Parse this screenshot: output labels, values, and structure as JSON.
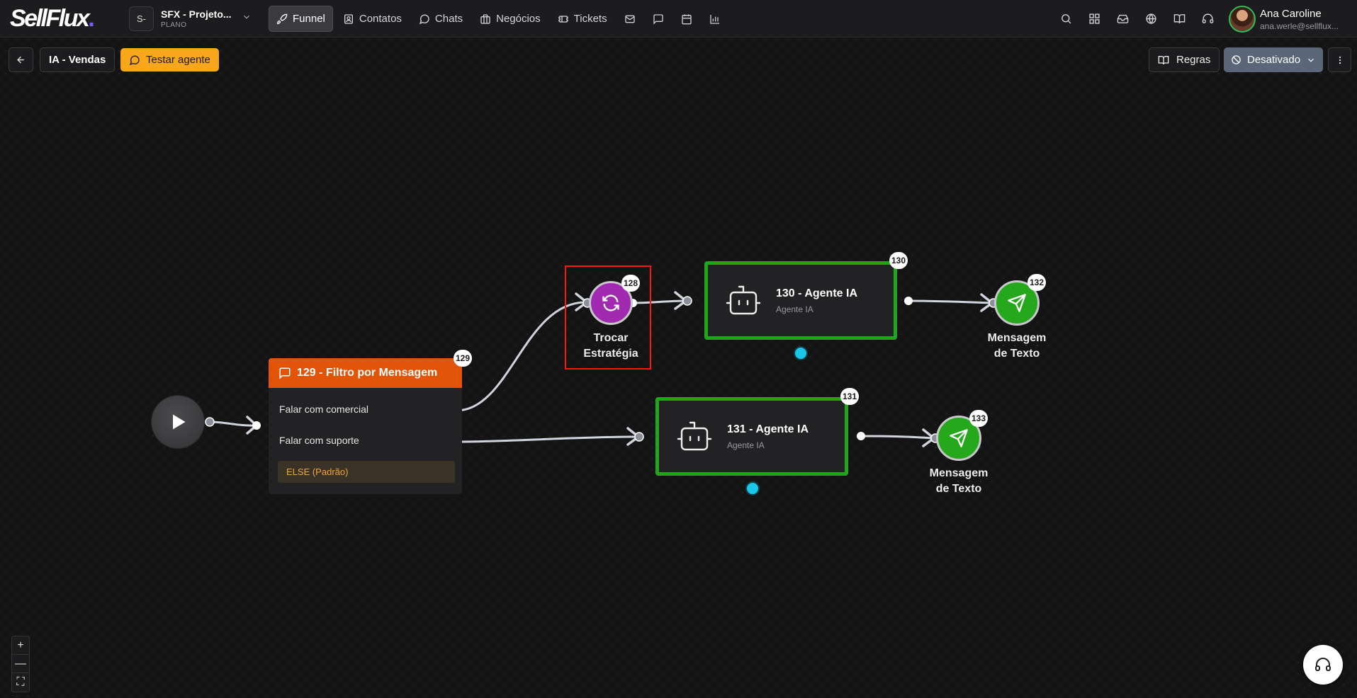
{
  "brand": {
    "logo_text": "SellFlux",
    "logo_dot": "."
  },
  "project": {
    "avatar": "S-",
    "name": "SFX - Projeto...",
    "plan": "PLANO"
  },
  "nav": {
    "items": [
      {
        "label": "Funnel",
        "icon": "rocket-icon",
        "active": true
      },
      {
        "label": "Contatos",
        "icon": "contacts-icon"
      },
      {
        "label": "Chats",
        "icon": "chat-icon"
      },
      {
        "label": "Negócios",
        "icon": "briefcase-icon"
      },
      {
        "label": "Tickets",
        "icon": "ticket-icon"
      }
    ],
    "icon_items": [
      "mail-icon",
      "message-square-icon",
      "calendar-icon",
      "bar-chart-icon"
    ]
  },
  "right_icons": [
    "search-icon",
    "grid-icon",
    "inbox-icon",
    "globe-icon",
    "book-icon",
    "headset-icon"
  ],
  "user": {
    "name": "Ana Caroline",
    "email": "ana.werle@sellflux..."
  },
  "toolbar": {
    "flow_name": "IA - Vendas",
    "test_label": "Testar agente",
    "rules_label": "Regras",
    "status_label": "Desativado"
  },
  "nodes": {
    "filter": {
      "badge": "129",
      "title": "129 - Filtro por Mensagem",
      "options": [
        "Falar com comercial",
        "Falar com suporte"
      ],
      "else_label": "ELSE (Padrão)"
    },
    "strategy": {
      "badge": "128",
      "label_line1": "Trocar",
      "label_line2": "Estratégia"
    },
    "agent_130": {
      "badge": "130",
      "title": "130 - Agente IA",
      "subtitle": "Agente IA"
    },
    "agent_131": {
      "badge": "131",
      "title": "131 - Agente IA",
      "subtitle": "Agente IA"
    },
    "msg_132": {
      "badge": "132",
      "label_line1": "Mensagem",
      "label_line2": "de Texto"
    },
    "msg_133": {
      "badge": "133",
      "label_line1": "Mensagem",
      "label_line2": "de Texto"
    }
  },
  "colors": {
    "filter_header": "#e25508",
    "agent_border": "#21a51b",
    "strategy_fill": "#a12ab0",
    "message_fill": "#26a81c",
    "test_button": "#f8a61c",
    "status_button": "#5b6778",
    "highlight": "#ff1414"
  },
  "zoom": {
    "in": "+",
    "out": "—",
    "fit": "⛶"
  }
}
